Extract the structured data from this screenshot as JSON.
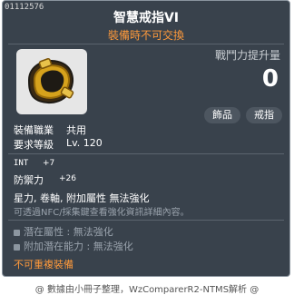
{
  "item": {
    "id": "01112576",
    "name": "智慧戒指VI",
    "trade_note": "裝備時不可交換",
    "power_label": "戰鬥力提升量",
    "power_value": "0",
    "tags": [
      "飾品",
      "戒指"
    ],
    "job_label": "裝備職業",
    "job_value": "共用",
    "level_label": "要求等級",
    "level_value": "Lv. 120"
  },
  "stats": {
    "int_label": "INT",
    "int_value": "+7",
    "def_label": "防禦力",
    "def_value": "+26"
  },
  "props": {
    "flags": "星力, 卷軸, 附加屬性 無法強化",
    "note": "可透過NFC/採集鍵查看強化資訊詳細內容。"
  },
  "potential": {
    "potential_label": "潛在屬性",
    "potential_value": "無法強化",
    "additional_label": "附加潛在能力",
    "additional_value": "無法強化"
  },
  "warning": "不可重複裝備",
  "footer": "@ 數據由小冊子整理，WzComparerR2-NTMS解析 @",
  "colors": {
    "panel": "#39424c",
    "accent": "#ff9a3b",
    "ring_gold": "#d6a21c"
  },
  "icons": {
    "item": "gold-ring-icon"
  }
}
